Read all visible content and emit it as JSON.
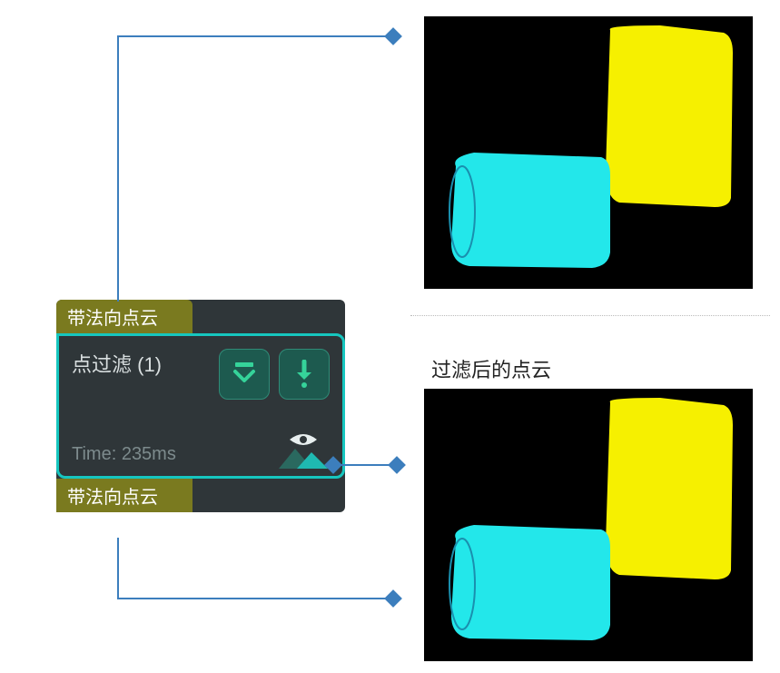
{
  "node": {
    "input_port": "带法向点云",
    "title": "点过滤 (1)",
    "time": "Time: 235ms",
    "output_port": "带法向点云"
  },
  "caption_filtered": "过滤后的点云",
  "icons": {
    "expand": "chevrons-down-icon",
    "run": "arrow-down-force-icon",
    "viz": "visibility-mountain-icon"
  },
  "colors": {
    "accent": "#16c6bf",
    "port_bg": "#7a7a1f",
    "node_bg": "#2f3639",
    "cyan_blob": "#23e7ea",
    "yellow_blob": "#f6f000",
    "connector": "#3c7ebd"
  }
}
